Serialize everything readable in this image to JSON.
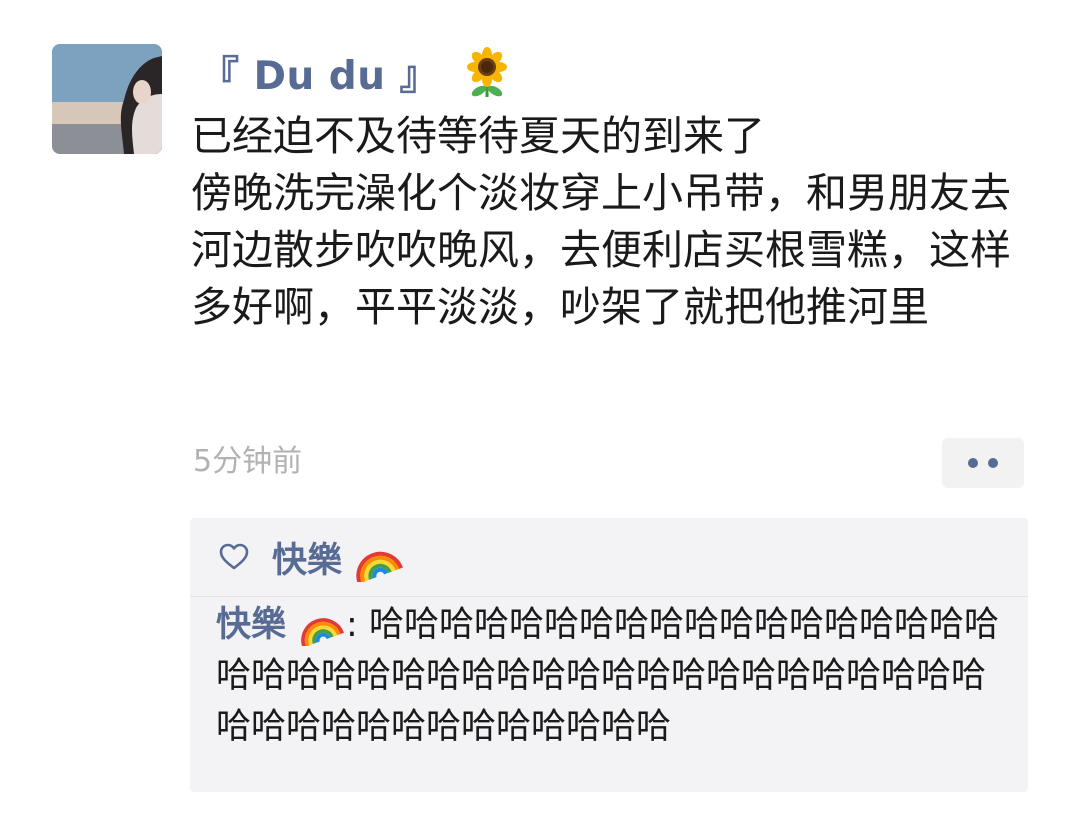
{
  "post": {
    "username": "『 Du du 』",
    "text": "已经迫不及待等待夏天的到来了\n傍晚洗完澡化个淡妆穿上小吊带，和男朋友去河边散步吹吹晚风，去便利店买根雪糕，这样多好啊，平平淡淡，吵架了就把他推河里",
    "timestamp": "5分钟前"
  },
  "feedback": {
    "like_name": "快樂",
    "comment": {
      "author": "快樂",
      "separator": ": ",
      "text": "哈哈哈哈哈哈哈哈哈哈哈哈哈哈哈哈哈哈哈哈哈哈哈哈哈哈哈哈哈哈哈哈哈哈哈哈哈哈哈哈哈哈哈哈哈哈哈哈哈哈哈哈哈"
    }
  },
  "colors": {
    "link_blue": "#576b95",
    "body_text": "#1a1a1a",
    "timestamp_gray": "#b2b2b2",
    "feedback_background": "#f3f3f5"
  },
  "icons": {
    "username_emoji": "sunflower-icon",
    "like": "heart-outline-icon",
    "name_emoji": "rainbow-icon",
    "more": "two-dot-more-icon"
  }
}
